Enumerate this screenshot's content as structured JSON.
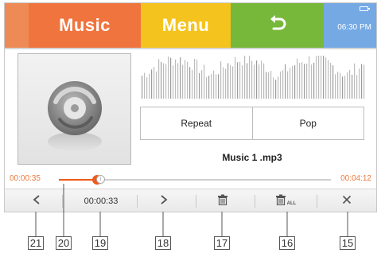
{
  "header": {
    "music_label": "Music",
    "menu_label": "Menu",
    "clock": "06:30 PM",
    "back_icon": "back-arrow-icon",
    "battery_icon": "battery-icon",
    "colors": {
      "accent": "#ee8a55",
      "music": "#f0743e",
      "menu": "#f4c31e",
      "back": "#77b83b",
      "clock": "#74a9e4"
    }
  },
  "player": {
    "mode_left": "Repeat",
    "mode_right": "Pop",
    "track": "Music 1 .mp3",
    "album_icon": "disc-icon"
  },
  "progress": {
    "elapsed": "00:00:35",
    "total": "00:04:12",
    "fraction": 0.139,
    "color": "#ef5a1d"
  },
  "toolbar": {
    "prev_icon": "chevron-left-icon",
    "time_label": "00:00:33",
    "next_icon": "chevron-right-icon",
    "delete_icon": "trash-icon",
    "delete_all_icon": "trash-all-icon",
    "delete_all_sub": "ALL",
    "close_icon": "close-icon"
  },
  "callouts": [
    "21",
    "20",
    "19",
    "18",
    "17",
    "16",
    "15"
  ]
}
